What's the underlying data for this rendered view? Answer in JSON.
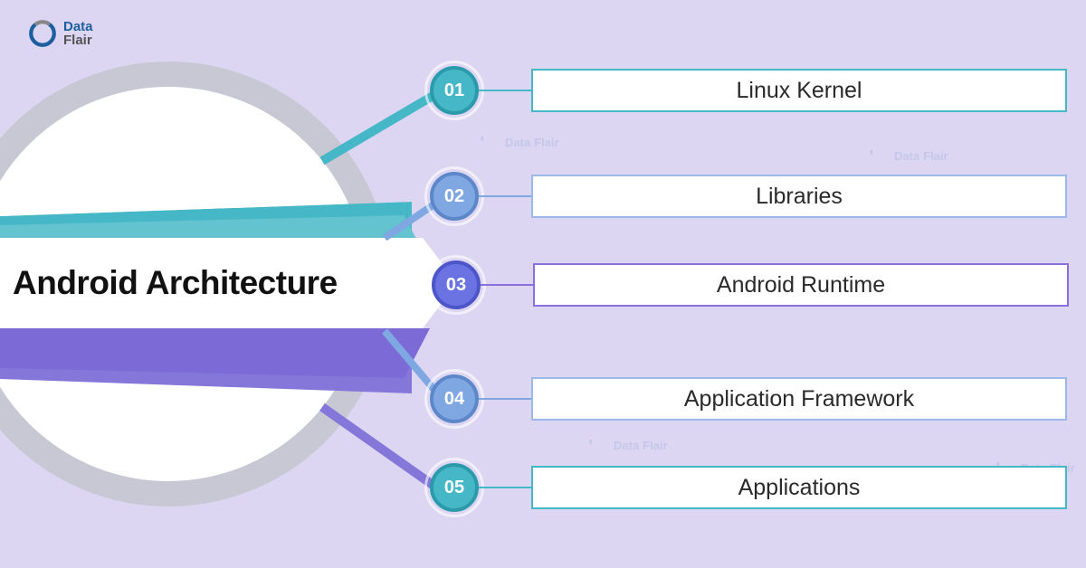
{
  "logo": {
    "line1": "Data",
    "line2": "Flair"
  },
  "title": "Android Architecture",
  "items": [
    {
      "num": "01",
      "label": "Linux Kernel"
    },
    {
      "num": "02",
      "label": "Libraries"
    },
    {
      "num": "03",
      "label": "Android Runtime"
    },
    {
      "num": "04",
      "label": "Application Framework"
    },
    {
      "num": "05",
      "label": "Applications"
    }
  ]
}
